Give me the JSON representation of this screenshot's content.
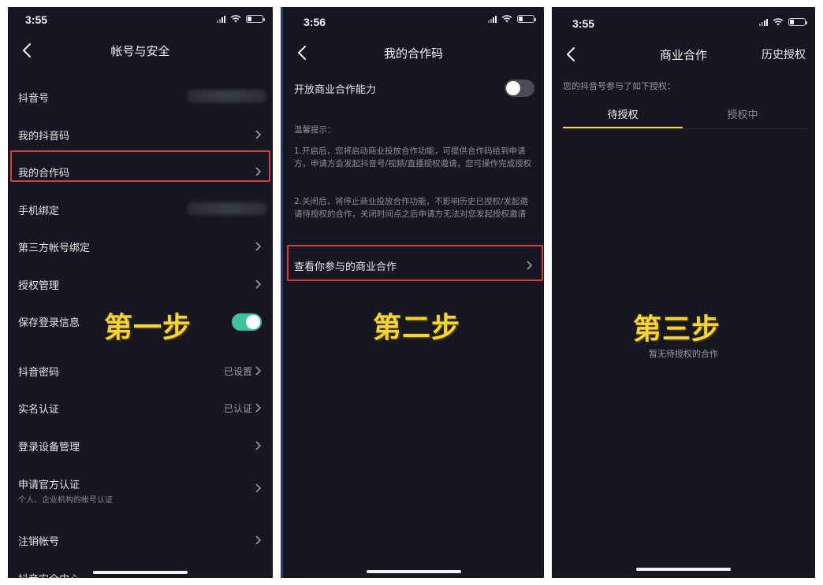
{
  "panel1": {
    "status_time": "3:55",
    "title": "帐号与安全",
    "rows": [
      {
        "label": "抖音号",
        "value": ""
      },
      {
        "label": "我的抖音码",
        "value": ""
      },
      {
        "label": "我的合作码",
        "value": ""
      },
      {
        "label": "手机绑定",
        "value": ""
      },
      {
        "label": "第三方帐号绑定",
        "value": ""
      },
      {
        "label": "授权管理",
        "value": ""
      },
      {
        "label": "保存登录信息",
        "value": ""
      },
      {
        "label": "抖音密码",
        "value": "已设置"
      },
      {
        "label": "实名认证",
        "value": "已认证"
      },
      {
        "label": "登录设备管理",
        "value": ""
      },
      {
        "label": "申请官方认证",
        "sub": "个人、企业机构的帐号认证"
      },
      {
        "label": "注销帐号",
        "value": ""
      },
      {
        "label": "抖音安全中心",
        "value": ""
      }
    ],
    "save_login_toggle": "on",
    "step_label": "第一步"
  },
  "panel2": {
    "status_time": "3:56",
    "title": "我的合作码",
    "toggle_label": "开放商业合作能力",
    "toggle_state": "off",
    "hint_title": "温馨提示：",
    "hint_1": "1.开启后，您将启动商业投放合作功能，可提供合作码给到申请方，申请方会发起抖音号/视频/直播授权邀请，您可操作完成授权",
    "hint_2": "2.关闭后，将停止商业投放合作功能，不影响历史已授权/发起邀请待授权的合作，关闭时间点之后申请方无法对您发起授权邀请",
    "link_label": "查看你参与的商业合作",
    "step_label": "第二步"
  },
  "panel3": {
    "status_time": "3:55",
    "title": "商业合作",
    "right_action": "历史授权",
    "intro": "您的抖音号参与了如下授权：",
    "tabs": [
      "待授权",
      "授权中"
    ],
    "active_tab": 0,
    "empty_text": "暂无待授权的合作",
    "step_label": "第三步"
  },
  "colors": {
    "background": "#161722",
    "accent": "#f4d43a",
    "highlight": "#d93c3c",
    "toggle_on": "#3cc39b"
  },
  "icons": [
    "back-arrow-icon",
    "chevron-right-icon",
    "signal-icon",
    "wifi-icon",
    "battery-icon"
  ]
}
